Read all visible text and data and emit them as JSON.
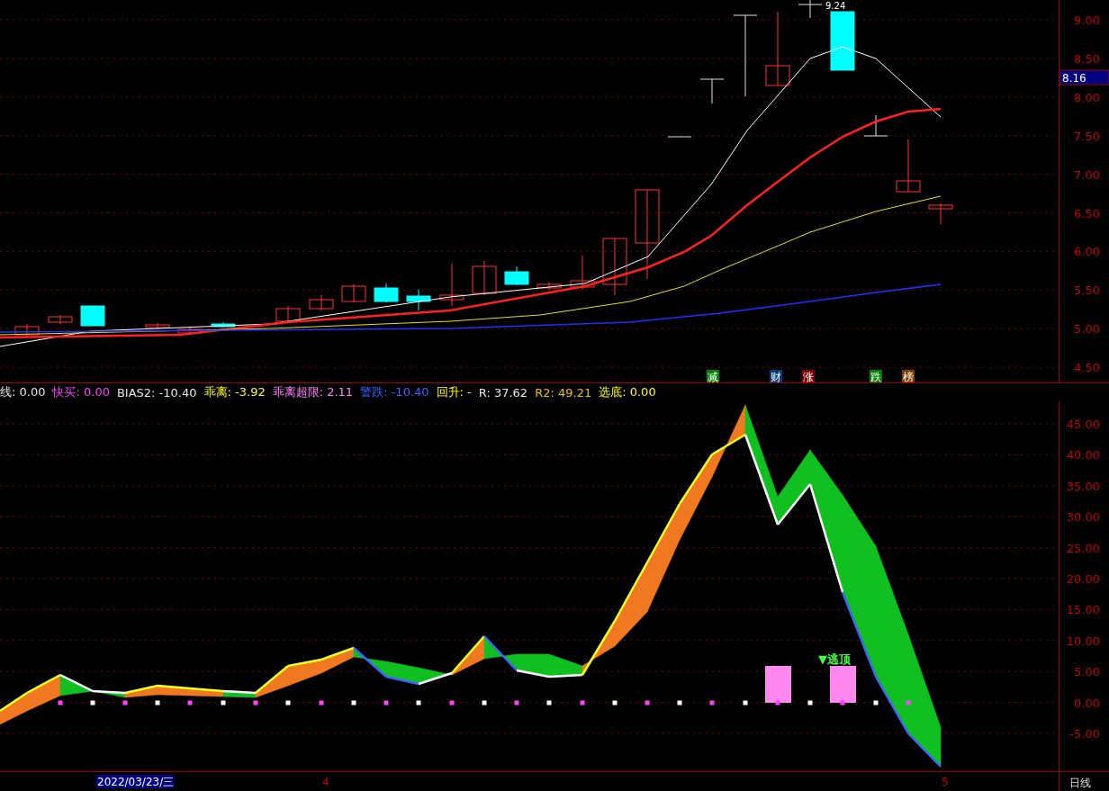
{
  "price_panel": {
    "axis_ticks": [
      "9.00",
      "8.50",
      "8.00",
      "7.50",
      "7.00",
      "6.50",
      "6.00",
      "5.50",
      "5.00",
      "4.50"
    ],
    "current_price": "8.16",
    "high_label": "9.24",
    "signals": [
      {
        "text": "减",
        "color": "#008000"
      },
      {
        "text": "财",
        "color": "#003c78"
      },
      {
        "text": "涨",
        "color": "#800000"
      },
      {
        "text": "跌",
        "color": "#008000"
      },
      {
        "text": "榜",
        "color": "#804000"
      }
    ]
  },
  "indicator_panel": {
    "legend": [
      {
        "text": "线: 0.00",
        "color": "#e6e6e6"
      },
      {
        "text": "快买: 0.00",
        "color": "#ff40ff"
      },
      {
        "text": "BIAS2: -10.40",
        "color": "#e6e6e6"
      },
      {
        "text": "乖离: -3.92",
        "color": "#ffff00"
      },
      {
        "text": "乖离超限: 2.11",
        "color": "#ff80ff"
      },
      {
        "text": "警跌: -10.40",
        "color": "#3c64ff"
      },
      {
        "text": "回升: -",
        "color": "#ffff00"
      },
      {
        "text": "R: 37.62",
        "color": "#e6e6e6"
      },
      {
        "text": "R2: 49.21",
        "color": "#e6c000"
      },
      {
        "text": "选底: 0.00",
        "color": "#ffff00"
      }
    ],
    "axis_ticks": [
      "45.00",
      "40.00",
      "35.00",
      "30.00",
      "25.00",
      "20.00",
      "15.00",
      "10.00",
      "5.00",
      "0.00",
      "-5.00"
    ],
    "signal_label": "▼逃顶"
  },
  "time_axis": {
    "labels": [
      {
        "text": "2022/03/23/三",
        "selected": true
      },
      {
        "text": "4",
        "selected": false
      },
      {
        "text": "5",
        "selected": false
      }
    ],
    "period": "日线"
  }
}
